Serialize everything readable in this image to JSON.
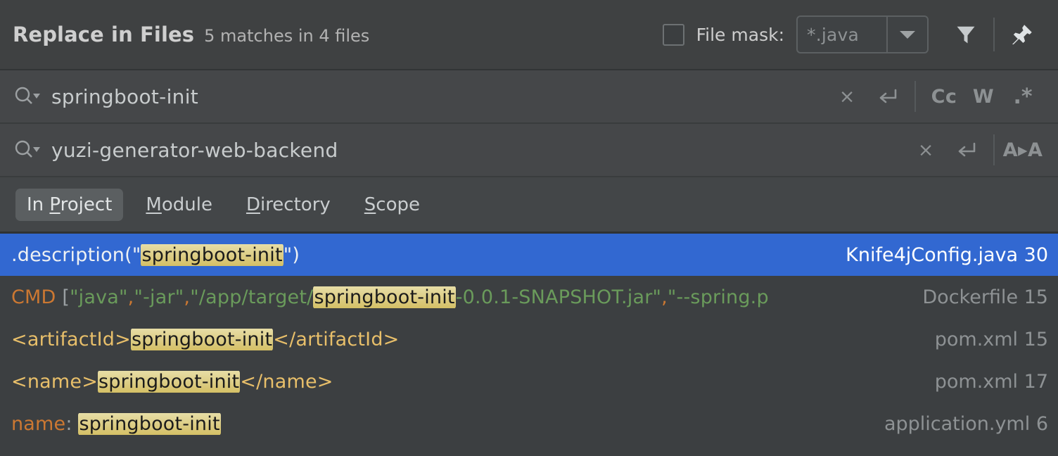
{
  "header": {
    "title": "Replace in Files",
    "subtitle": "5 matches in 4 files",
    "file_mask_label": "File mask:",
    "file_mask_value": "*.java",
    "file_mask_checked": false,
    "filter_icon": "filter-funnel-icon",
    "pin_icon": "pin-icon"
  },
  "search": {
    "icon": "search-dropdown-icon",
    "value": "springboot-init",
    "clear_label": "×",
    "history_icon": "return-arrow-icon",
    "match_case_label": "Cc",
    "words_label": "W",
    "regex_label": ".*"
  },
  "replace": {
    "icon": "search-dropdown-icon",
    "value": "yuzi-generator-web-backend",
    "clear_label": "×",
    "history_icon": "return-arrow-icon",
    "preserve_case_label": "A▸A"
  },
  "scope": {
    "tabs": [
      {
        "label": "In Project",
        "accel_before": "In ",
        "accel": "P",
        "accel_after": "roject",
        "selected": true
      },
      {
        "label": "Module",
        "accel_before": "",
        "accel": "M",
        "accel_after": "odule",
        "selected": false
      },
      {
        "label": "Directory",
        "accel_before": "",
        "accel": "D",
        "accel_after": "irectory",
        "selected": false
      },
      {
        "label": "Scope",
        "accel_before": "",
        "accel": "S",
        "accel_after": "cope",
        "selected": false
      }
    ]
  },
  "results": [
    {
      "selected": true,
      "file": "Knife4jConfig.java",
      "line": "30",
      "location": "Knife4jConfig.java 30",
      "segments": [
        {
          "text": ".description(\"",
          "style": "c-white"
        },
        {
          "text": "springboot-init",
          "style": "hl"
        },
        {
          "text": "\")",
          "style": "c-white"
        }
      ]
    },
    {
      "selected": false,
      "file": "Dockerfile",
      "line": "15",
      "location": "Dockerfile 15",
      "segments": [
        {
          "text": "CMD ",
          "style": "c-orange"
        },
        {
          "text": "[",
          "style": "c-punct"
        },
        {
          "text": "\"java\"",
          "style": "c-green"
        },
        {
          "text": ",",
          "style": "c-orange"
        },
        {
          "text": "\"-jar\"",
          "style": "c-green"
        },
        {
          "text": ",",
          "style": "c-orange"
        },
        {
          "text": "\"/app/target/",
          "style": "c-green"
        },
        {
          "text": "springboot-init",
          "style": "hl"
        },
        {
          "text": "-0.0.1-SNAPSHOT.jar\"",
          "style": "c-green"
        },
        {
          "text": ",",
          "style": "c-orange"
        },
        {
          "text": "\"--spring.p",
          "style": "c-green"
        }
      ]
    },
    {
      "selected": false,
      "file": "pom.xml",
      "line": "15",
      "location": "pom.xml 15",
      "segments": [
        {
          "text": "<artifactId>",
          "style": "c-xml"
        },
        {
          "text": "springboot-init",
          "style": "hl"
        },
        {
          "text": "</artifactId>",
          "style": "c-xml"
        }
      ]
    },
    {
      "selected": false,
      "file": "pom.xml",
      "line": "17",
      "location": "pom.xml 17",
      "segments": [
        {
          "text": "<name>",
          "style": "c-xml"
        },
        {
          "text": "springboot-init",
          "style": "hl"
        },
        {
          "text": "</name>",
          "style": "c-xml"
        }
      ]
    },
    {
      "selected": false,
      "file": "application.yml",
      "line": "6",
      "location": "application.yml 6",
      "segments": [
        {
          "text": "name",
          "style": "c-orange"
        },
        {
          "text": ": ",
          "style": "c-punct"
        },
        {
          "text": "springboot-init",
          "style": "hl"
        }
      ]
    }
  ],
  "colors": {
    "selection_blue": "#3268d1",
    "highlight_gold": "#d4bf63",
    "header_bg": "#3f4142",
    "input_bg": "#454749",
    "results_bg": "#3c3f41",
    "keyword_orange": "#cc7832",
    "string_green": "#6a9b5b",
    "xml_tag_gold": "#e8bf6a"
  }
}
